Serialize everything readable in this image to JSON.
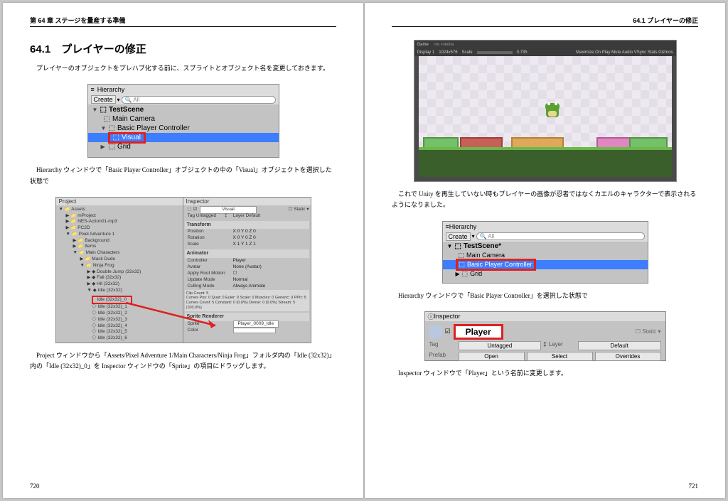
{
  "left_page": {
    "running_head": "第 64 章 ステージを量産する準備",
    "heading": "64.1　プレイヤーの修正",
    "para1": "プレイヤーのオブジェクトをプレハブ化する前に、スプライトとオブジェクト名を変更しておきます。",
    "fig1": {
      "tab": "Hierarchy",
      "create": "Create",
      "search": "All",
      "scene": "TestScene",
      "item1": "Main Camera",
      "item2": "Basic Player Controller",
      "item3": "Visual",
      "item4": "Grid"
    },
    "para2": "Hierarchy ウィンドウで「Basic Player Controller」オブジェクトの中の「Visual」オブジェクトを選択した状態で",
    "fig2": {
      "left_tab": "Project",
      "right_tab": "Inspector",
      "assets": "Assets",
      "folders": [
        "mProject",
        "NES-Action01-mp3",
        "PC2D",
        "Pixel Adventure 1",
        "Background",
        "Items",
        "Main Characters",
        "Mask Dude",
        "Ninja Frog"
      ],
      "ninja_items": [
        "Double Jump (32x32)",
        "Fall (32x32)",
        "Hit (32x32)",
        "Idle (32x32)",
        "Idle (32x32)_0",
        "Idle (32x32)_1",
        "Idle (32x32)_2",
        "Idle (32x32)_3",
        "Idle (32x32)_4",
        "Idle (32x32)_5",
        "Idle (32x32)_6"
      ],
      "selected": "Idle (32x32)_0",
      "visual": "Visual",
      "tag": "Tag  Untagged",
      "layer": "Layer  Default",
      "static": "Static",
      "transform": "Transform",
      "position": "Position",
      "rotation": "Rotation",
      "scale": "Scale",
      "xyz0": "X 0    Y 0    Z 0",
      "xyz1": "X 1    Y 1    Z 1",
      "animator": "Animator",
      "controller": "Controller",
      "controller_v": "Player",
      "avatar": "Avatar",
      "avatar_v": "None (Avatar)",
      "applyroot": "Apply Root Motion",
      "updatemode": "Update Mode",
      "updatemode_v": "Normal",
      "culling": "Culling Mode",
      "culling_v": "Always Animate",
      "clipinfo": "Clip Count: 5\nCurves Pos: 0 Quat: 0 Euler: 0 Scale: 0 Muscles: 0 Generic: 0 PPtr: 5\nCurves Count: 5 Constant: 0 (0.0%) Dense: 0 (0.0%) Stream: 5 (100.0%)",
      "sprite_renderer": "Sprite Renderer",
      "sprite": "Sprite",
      "sprite_v": "Player_0009_Idle",
      "color": "Color"
    },
    "para3": "Project ウィンドウから「Assets/Pixel Adventure 1/Main Characters/Ninja Frog」フォルダ内の「Idle (32x32)」内の「Idle (32x32)_0」を Inspector ウィンドウの「Sprite」の項目にドラッグします。",
    "pagenum": "720"
  },
  "right_page": {
    "running_head": "64.1 プレイヤーの修正",
    "fig3": {
      "tab_game": "Game",
      "tab_palette": "Tile Palette",
      "display": "Display 1",
      "res": "1024x576",
      "scale": "Scale",
      "scale_v": "0.735",
      "right_opts": "Maximize On Play   Mute Audio   VSync   Stats   Gizmos"
    },
    "para1": "これで Unity を再生していない時もプレイヤーの画像が忍者ではなくカエルのキャラクターで表示されるようになりました。",
    "fig4": {
      "tab": "Hierarchy",
      "create": "Create",
      "search": "All",
      "scene": "TestScene*",
      "item1": "Main Camera",
      "item2": "Basic Player Controller",
      "item3": "Grid"
    },
    "para2": "Hierarchy ウィンドウで「Basic Player Controller」を選択した状態で",
    "fig5": {
      "tab": "Inspector",
      "name": "Player",
      "static": "Static",
      "tag_l": "Tag",
      "tag_v": "Untagged",
      "layer_l": "Layer",
      "layer_v": "Default",
      "prefab_l": "Prefab",
      "btn_open": "Open",
      "btn_select": "Select",
      "btn_over": "Overrides"
    },
    "para3": "Inspector ウィンドウで「Player」という名前に変更します。",
    "pagenum": "721"
  }
}
